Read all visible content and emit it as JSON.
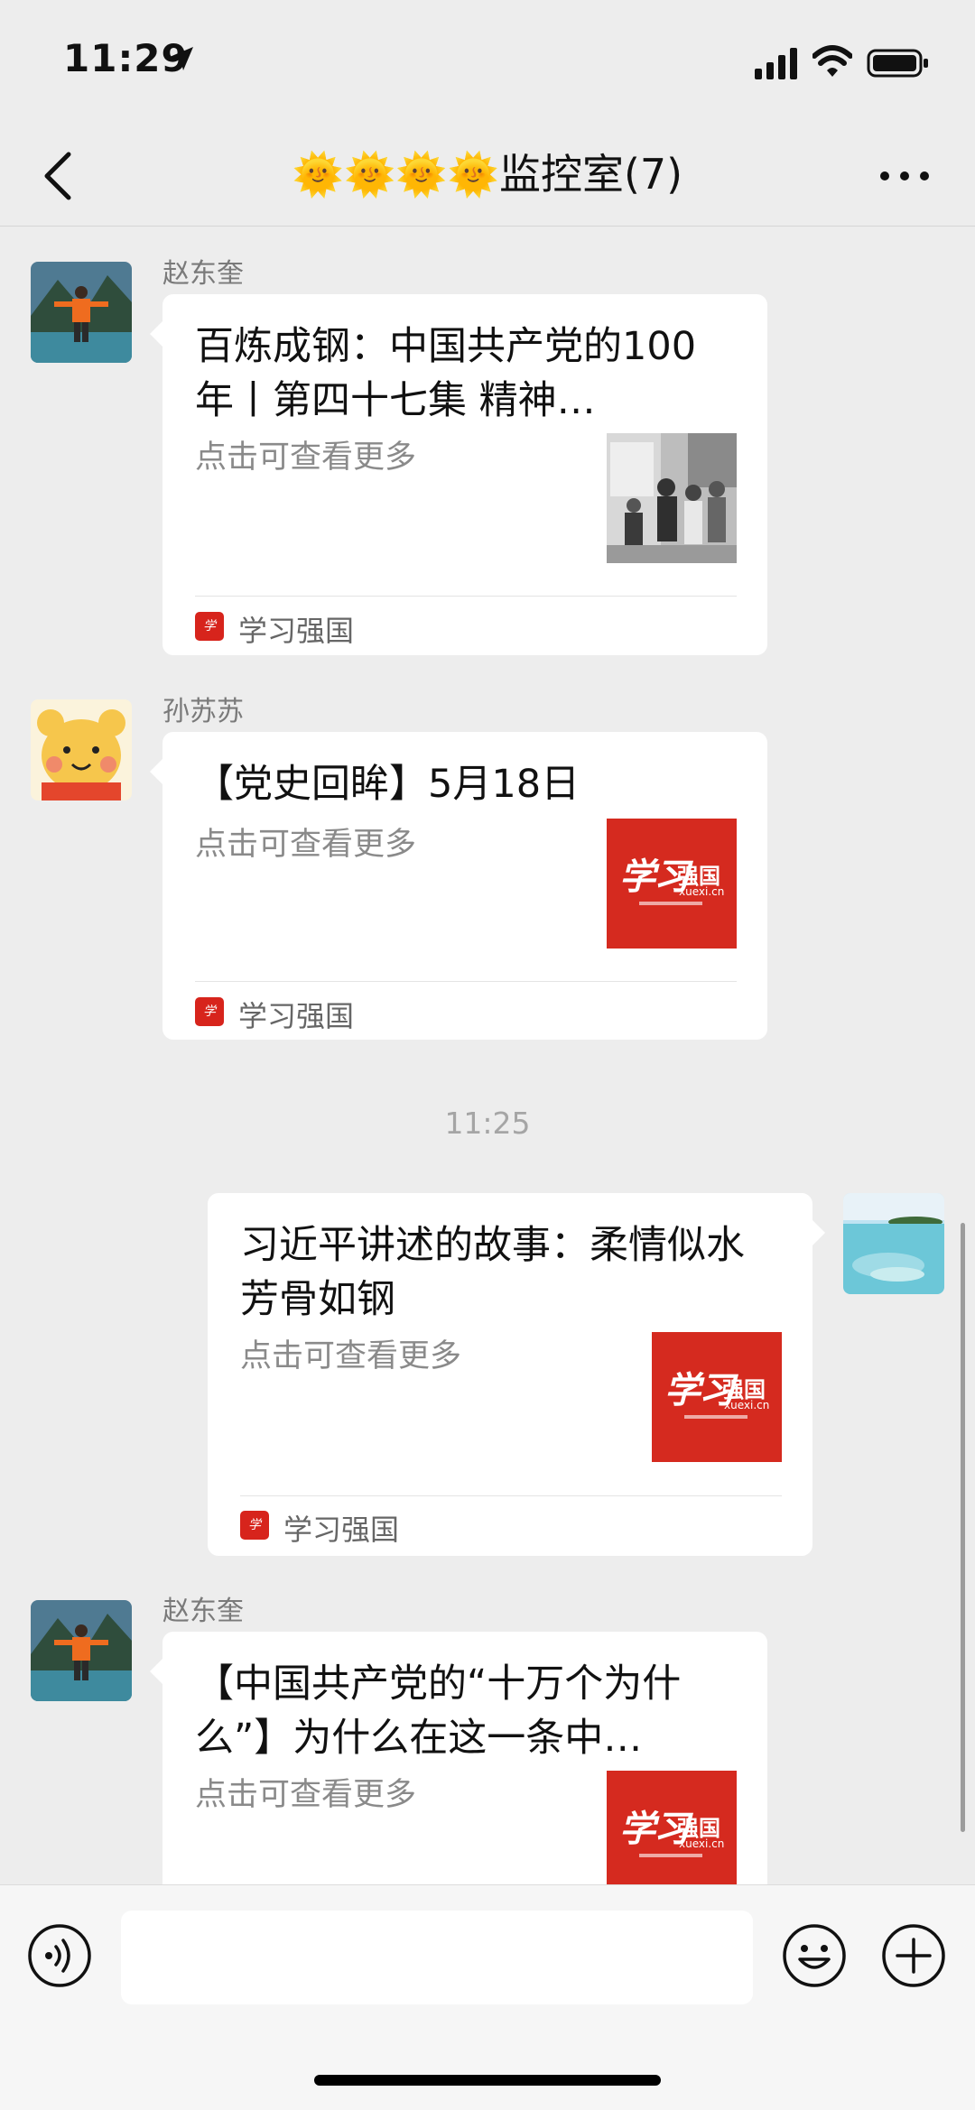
{
  "status": {
    "time": "11:29"
  },
  "header": {
    "title": "🌞🌞🌞🌞监控室(7)"
  },
  "messages": [
    {
      "sender": "赵东奎",
      "title": "百炼成钢：中国共产党的100年丨第四十七集 精神…",
      "desc": "点击可查看更多",
      "source": "学习强国"
    },
    {
      "sender": "孙苏苏",
      "title": "【党史回眸】5月18日",
      "desc": "点击可查看更多",
      "source": "学习强国",
      "thumb": {
        "calligraphy": "学习",
        "name": "强国",
        "url": "xuexi.cn"
      }
    },
    {
      "title": "习近平讲述的故事：柔情似水 芳骨如钢",
      "desc": "点击可查看更多",
      "source": "学习强国",
      "thumb": {
        "calligraphy": "学习",
        "name": "强国",
        "url": "xuexi.cn"
      }
    },
    {
      "sender": "赵东奎",
      "title": "【中国共产党的“十万个为什么”】为什么在这一条中…",
      "desc": "点击可查看更多",
      "thumb": {
        "calligraphy": "学习",
        "name": "强国",
        "url": "xuexi.cn"
      }
    }
  ],
  "timestamp": "11:25",
  "icons": {
    "back": "chevron-left-icon",
    "more": "more-icon",
    "voice": "voice-icon",
    "emoji": "emoji-icon",
    "plus": "plus-icon"
  },
  "colors": {
    "background": "#ededed",
    "bubble": "#ffffff",
    "brand_red": "#d52a1f"
  }
}
